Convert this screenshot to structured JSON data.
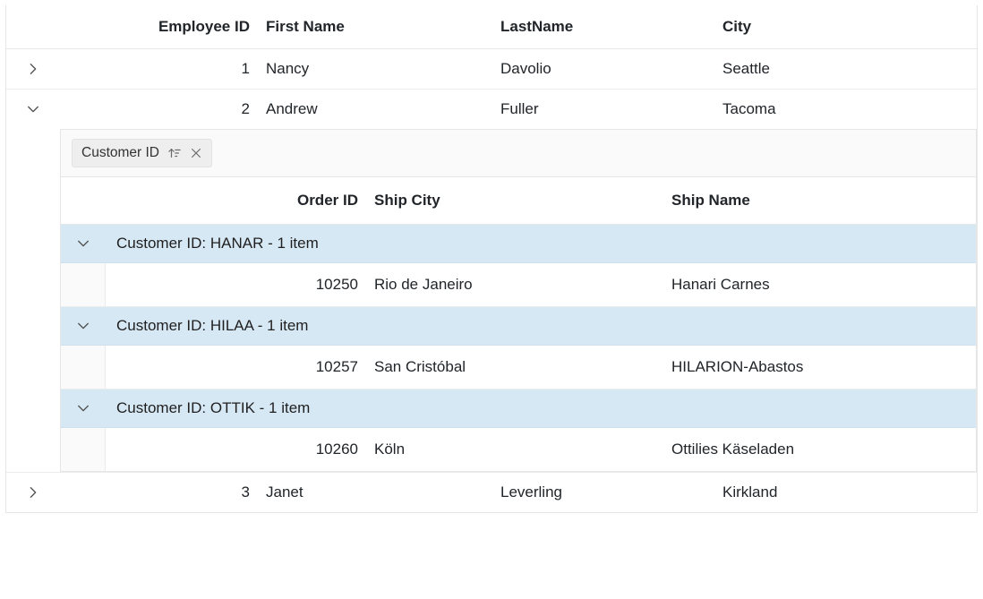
{
  "grid": {
    "columns": {
      "employee_id": "Employee ID",
      "first_name": "First Name",
      "last_name": "LastName",
      "city": "City"
    },
    "rows": [
      {
        "expanded": false,
        "employee_id": "1",
        "first_name": "Nancy",
        "last_name": "Davolio",
        "city": "Seattle"
      },
      {
        "expanded": true,
        "employee_id": "2",
        "first_name": "Andrew",
        "last_name": "Fuller",
        "city": "Tacoma"
      },
      {
        "expanded": false,
        "employee_id": "3",
        "first_name": "Janet",
        "last_name": "Leverling",
        "city": "Kirkland"
      }
    ]
  },
  "nested": {
    "group_by_chip": "Customer ID",
    "columns": {
      "order_id": "Order ID",
      "ship_city": "Ship City",
      "ship_name": "Ship Name"
    },
    "groups": [
      {
        "caption": "Customer ID: HANAR - 1 item",
        "row": {
          "order_id": "10250",
          "ship_city": "Rio de Janeiro",
          "ship_name": "Hanari Carnes"
        }
      },
      {
        "caption": "Customer ID: HILAA - 1 item",
        "row": {
          "order_id": "10257",
          "ship_city": "San Cristóbal",
          "ship_name": "HILARION-Abastos"
        }
      },
      {
        "caption": "Customer ID: OTTIK - 1 item",
        "row": {
          "order_id": "10260",
          "ship_city": "Köln",
          "ship_name": "Ottilies Käseladen"
        }
      }
    ]
  }
}
